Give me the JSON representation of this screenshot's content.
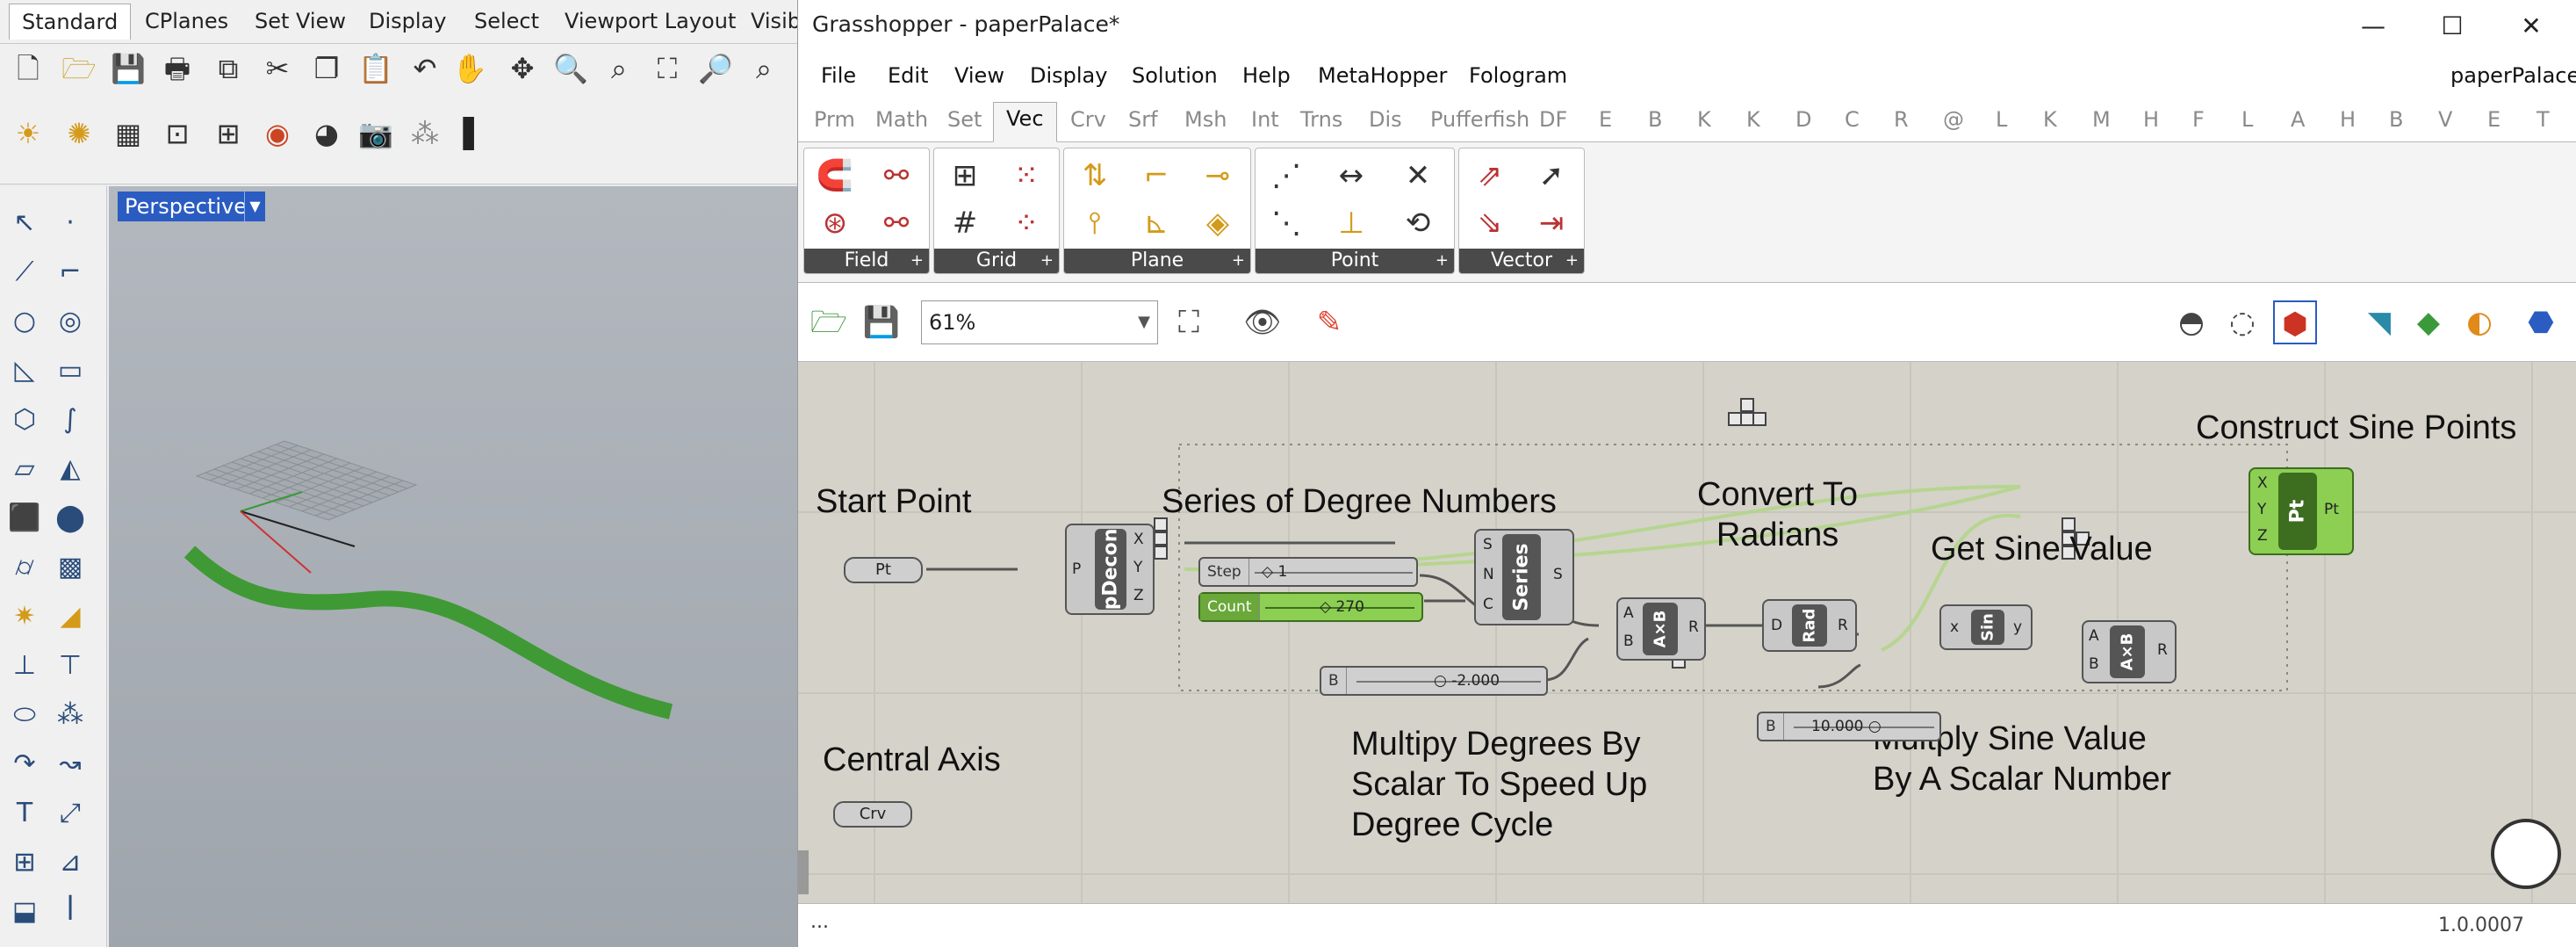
{
  "rhino": {
    "tabs": [
      "Standard",
      "CPlanes",
      "Set View",
      "Display",
      "Select",
      "Viewport Layout",
      "Visib"
    ],
    "viewport_label": "Perspective"
  },
  "gh": {
    "title": "Grasshopper - paperPalace*",
    "doc_name": "paperPalace",
    "menu": [
      "File",
      "Edit",
      "View",
      "Display",
      "Solution",
      "Help",
      "MetaHopper",
      "Fologram"
    ],
    "tabs": [
      "Prm",
      "Math",
      "Set",
      "Vec",
      "Crv",
      "Srf",
      "Msh",
      "Int",
      "Trns",
      "Dis",
      "Pufferfish",
      "DF",
      "E",
      "B",
      "K",
      "K",
      "D",
      "C",
      "R",
      "@",
      "L",
      "K",
      "M",
      "H",
      "F",
      "L",
      "A",
      "H",
      "B",
      "V",
      "E",
      "T"
    ],
    "active_tab": "Vec",
    "ribbon_panels": [
      "Field",
      "Grid",
      "Plane",
      "Point",
      "Vector"
    ],
    "zoom": "61%",
    "status_left": "...",
    "status_right": "1.0.0007",
    "canvas": {
      "groups": {
        "start_point": "Start Point",
        "series": "Series of Degree Numbers",
        "convert": "Convert To\nRadians",
        "construct": "Construct Sine Points",
        "sine": "Get Sine Value",
        "multiply_deg": "Multipy Degrees By\nScalar To Speed Up\nDegree Cycle",
        "multiply_sine": "Multply Sine Value\nBy A Scalar Number",
        "central_axis": "Central Axis"
      },
      "nodes": {
        "pt_param": "Pt",
        "pdecon": "pDecon",
        "pdecon_in": "P",
        "pdecon_out": [
          "X",
          "Y",
          "Z"
        ],
        "series": "Series",
        "series_in": [
          "S",
          "N",
          "C"
        ],
        "series_out": "S",
        "step_label": "Step",
        "step_value": "1",
        "count_label": "Count",
        "count_value": "270",
        "b1_label": "B",
        "b1_value": "-2.000",
        "axb1": "A×B",
        "axb_in": [
          "A",
          "B"
        ],
        "axb_out": "R",
        "rad": "Rad",
        "rad_in": "D",
        "rad_out": "R",
        "sin": "Sin",
        "sin_in": "x",
        "sin_out": "y",
        "b2_label": "B",
        "b2_value": "10.000",
        "axb2": "A×B",
        "pt_node": "Pt",
        "pt_in": [
          "X",
          "Y",
          "Z"
        ],
        "pt_out": "Pt",
        "crv_param": "Crv"
      }
    }
  }
}
